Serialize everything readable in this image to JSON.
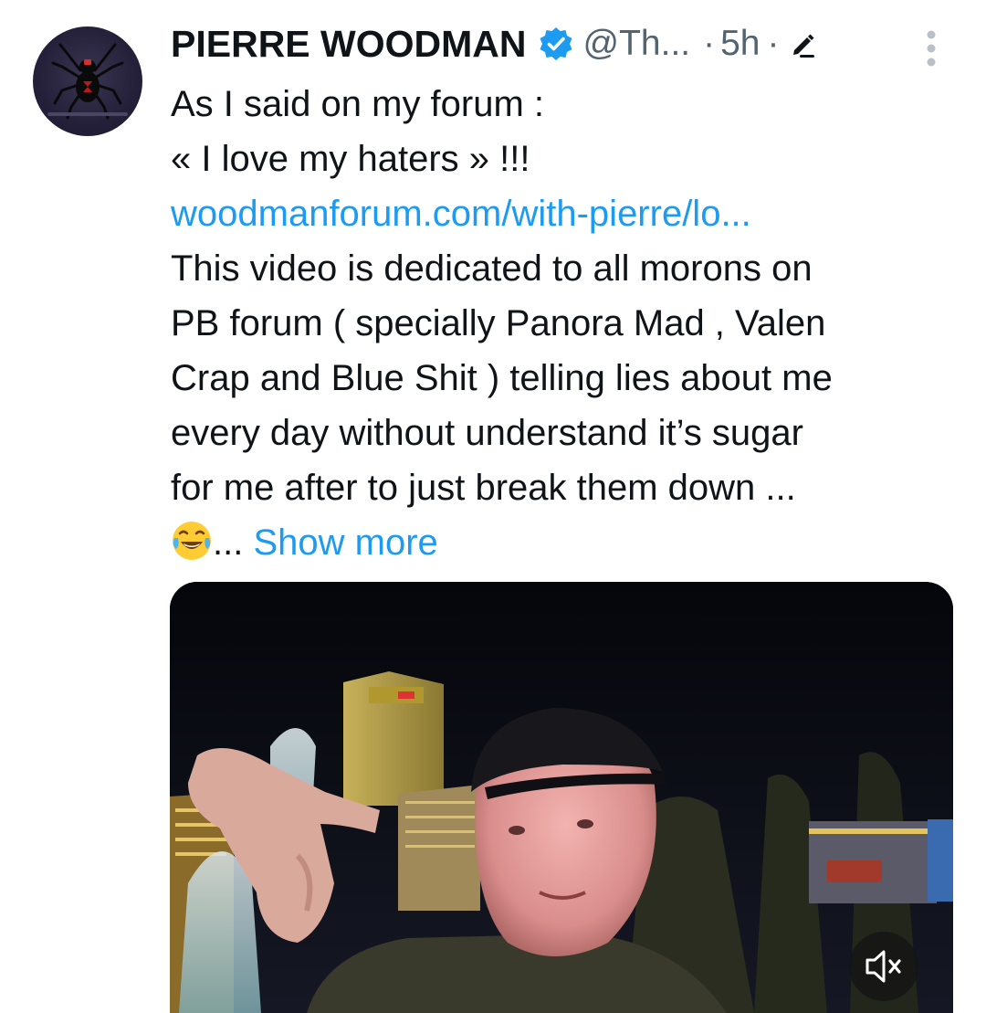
{
  "tweet": {
    "author_name": "PIERRE WOODMAN",
    "handle": "@Th...",
    "separator": "·",
    "time": "5h",
    "lines": [
      "As I said on my forum :",
      "« I love my haters » !!!",
      "woodmanforum.com/with-pierre/lo...",
      "This video is dedicated to all morons on",
      "PB forum ( specially Panora Mad , Valen",
      "Crap and Blue Shit ) telling lies about me",
      "every day without understand it’s sugar",
      "for me after to just break them down ..."
    ],
    "last_line_suffix": "...",
    "show_more": "Show more"
  },
  "icons": {
    "verified": "verified-badge-icon",
    "edit": "edited-pencil-icon",
    "more": "more-options-icon",
    "emoji": "laughing-tears-emoji",
    "mute": "muted-speaker-icon"
  },
  "colors": {
    "text": "#0f1419",
    "secondary": "#536471",
    "link": "#1d9bf0",
    "verified": "#1d9bf0"
  }
}
